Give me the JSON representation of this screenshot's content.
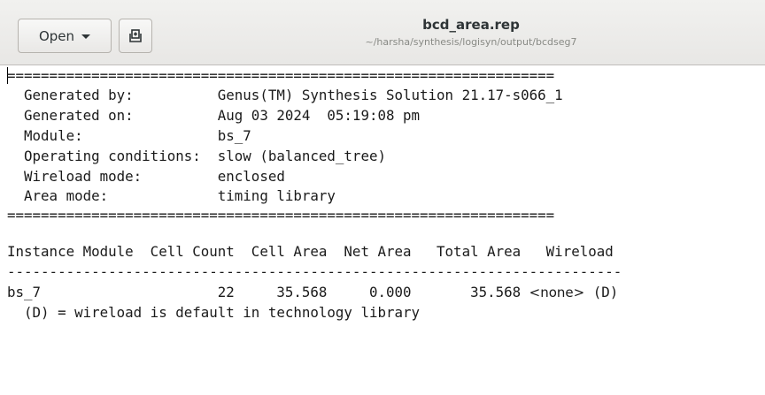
{
  "toolbar": {
    "open_label": "Open",
    "new_document_icon": "new-document-icon"
  },
  "document": {
    "title": "bcd_area.rep",
    "path": "~/harsha/synthesis/logisyn/output/bcdseg7"
  },
  "report": {
    "separator": "=================================================================",
    "header": {
      "generated_by": "  Generated by:          Genus(TM) Synthesis Solution 21.17-s066_1",
      "generated_on": "  Generated on:          Aug 03 2024  05:19:08 pm",
      "module": "  Module:                bs_7",
      "operating_conditions": "  Operating conditions:  slow (balanced_tree)",
      "wireload_mode": "  Wireload mode:         enclosed",
      "area_mode": "  Area mode:             timing library"
    },
    "blank": "",
    "table_header": "Instance Module  Cell Count  Cell Area  Net Area   Total Area   Wireload",
    "table_rule": "-------------------------------------------------------------------------",
    "row": {
      "values": "bs_7                     22     35.568     0.000       35.568 ",
      "wireload": "<none>",
      "wireload_suffix": " (D)"
    },
    "footnote": "  (D) = wireload is default in technology library"
  }
}
